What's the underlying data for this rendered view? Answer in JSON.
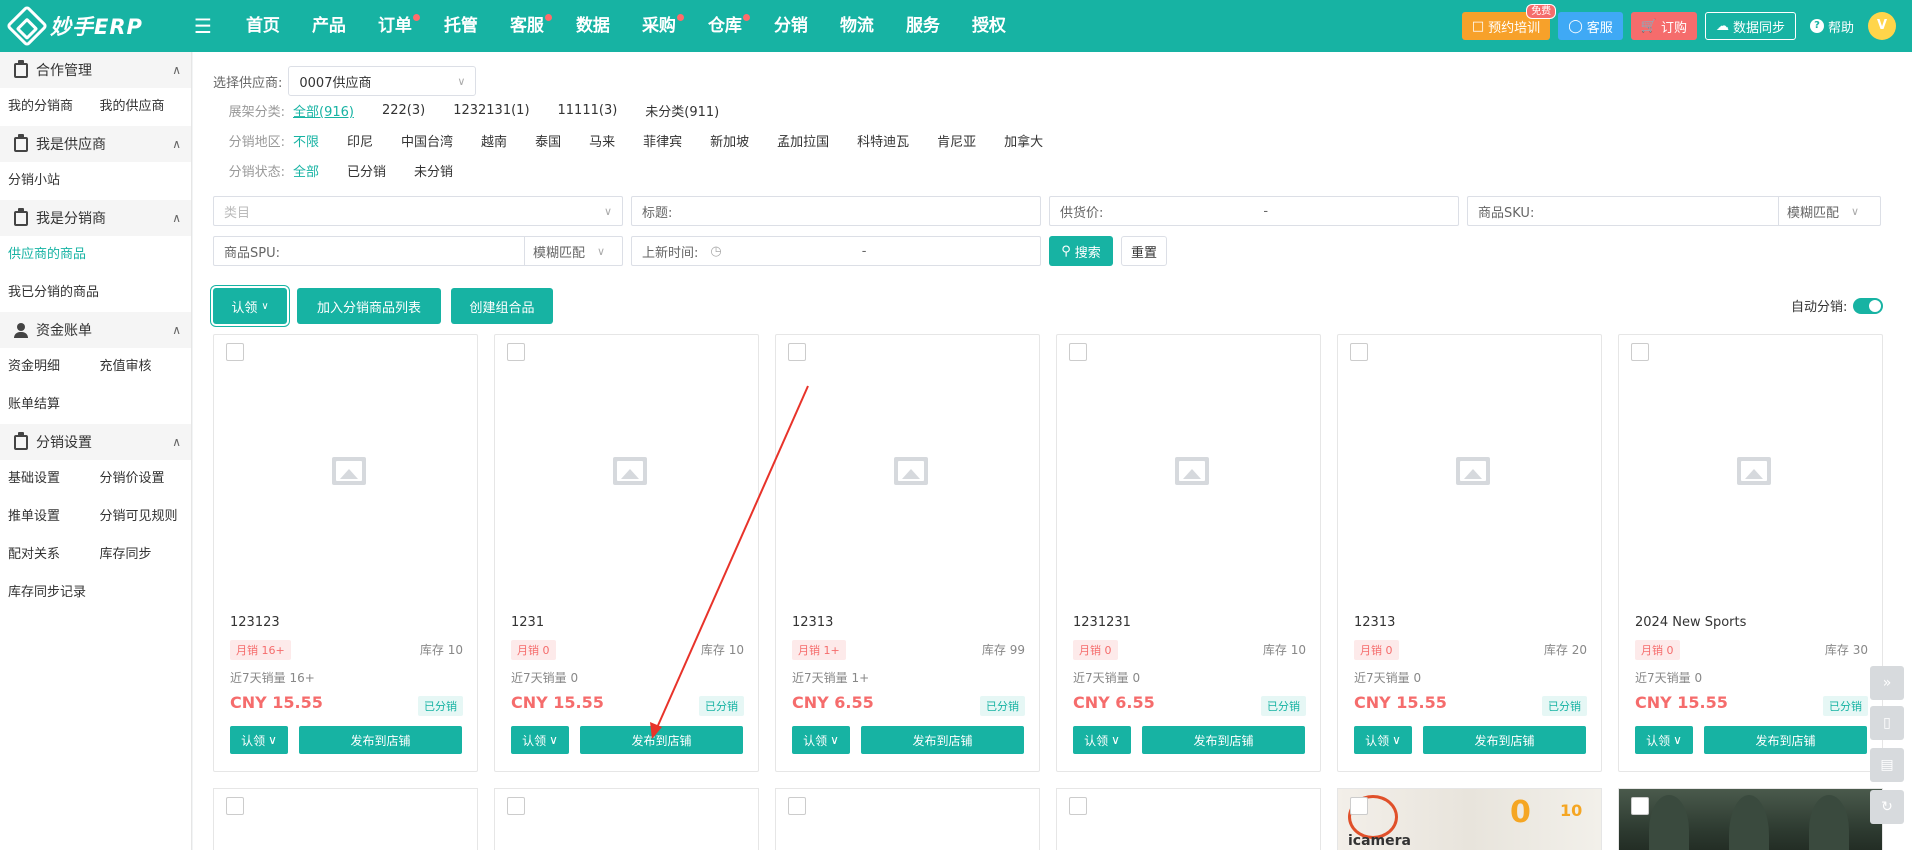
{
  "header": {
    "logo_text": "妙手ERP",
    "nav": [
      {
        "label": "首页",
        "dot": false
      },
      {
        "label": "产品",
        "dot": false
      },
      {
        "label": "订单",
        "dot": true
      },
      {
        "label": "托管",
        "dot": false
      },
      {
        "label": "客服",
        "dot": true
      },
      {
        "label": "数据",
        "dot": false
      },
      {
        "label": "采购",
        "dot": true
      },
      {
        "label": "仓库",
        "dot": true
      },
      {
        "label": "分销",
        "dot": false
      },
      {
        "label": "物流",
        "dot": false
      },
      {
        "label": "服务",
        "dot": false
      },
      {
        "label": "授权",
        "dot": false
      }
    ],
    "training_label": "预约培训",
    "free_badge": "免费",
    "service_label": "客服",
    "subscribe_label": "订购",
    "sync_label": "数据同步",
    "help_label": "帮助",
    "avatar_letter": "V"
  },
  "sidebar": {
    "groups": [
      {
        "title": "合作管理",
        "icon": "clipboard-icon",
        "items": [
          "我的分销商",
          "我的供应商"
        ]
      },
      {
        "title": "我是供应商",
        "icon": "clipboard-icon",
        "items": [
          "分销小站"
        ]
      },
      {
        "title": "我是分销商",
        "icon": "clipboard-icon",
        "items": [
          "供应商的商品",
          "我已分销的商品"
        ]
      },
      {
        "title": "资金账单",
        "icon": "user-icon",
        "items": [
          "资金明细",
          "充值审核",
          "账单结算"
        ]
      },
      {
        "title": "分销设置",
        "icon": "clipboard-icon",
        "items": [
          "基础设置",
          "分销价设置",
          "推单设置",
          "分销可见规则",
          "配对关系",
          "库存同步",
          "库存同步记录"
        ]
      }
    ],
    "active_item": "供应商的商品"
  },
  "filters": {
    "supplier_label": "选择供应商:",
    "supplier_value": "0007供应商",
    "category_label": "展架分类:",
    "category_options": [
      "全部(916)",
      "222(3)",
      "1232131(1)",
      "11111(3)",
      "未分类(911)"
    ],
    "region_label": "分销地区:",
    "region_options": [
      "不限",
      "印尼",
      "中国台湾",
      "越南",
      "泰国",
      "马来",
      "菲律宾",
      "新加坡",
      "孟加拉国",
      "科特迪瓦",
      "肯尼亚",
      "加拿大"
    ],
    "status_label": "分销状态:",
    "status_options": [
      "全部",
      "已分销",
      "未分销"
    ]
  },
  "search": {
    "category_placeholder": "类目",
    "title_label": "标题:",
    "price_label": "供货价:",
    "price_sep": "-",
    "sku_label": "商品SKU:",
    "sku_match": "模糊匹配",
    "spu_label": "商品SPU:",
    "spu_match": "模糊匹配",
    "time_label": "上新时间:",
    "time_sep": "-",
    "search_btn": "搜索",
    "reset_btn": "重置"
  },
  "toolbar": {
    "claim_label": "认领",
    "add_list_label": "加入分销商品列表",
    "create_combo_label": "创建组合品",
    "auto_dist_label": "自动分销:"
  },
  "products": [
    {
      "title": "123123",
      "month_sales": "月销 16+",
      "stock": "库存 10",
      "sales7": "近7天销量 16+",
      "price": "CNY 15.55",
      "status": "已分销"
    },
    {
      "title": "1231",
      "month_sales": "月销 0",
      "stock": "库存 10",
      "sales7": "近7天销量 0",
      "price": "CNY 15.55",
      "status": "已分销"
    },
    {
      "title": "12313",
      "month_sales": "月销 1+",
      "stock": "库存 99",
      "sales7": "近7天销量 1+",
      "price": "CNY 6.55",
      "status": "已分销"
    },
    {
      "title": "1231231",
      "month_sales": "月销 0",
      "stock": "库存 10",
      "sales7": "近7天销量 0",
      "price": "CNY 6.55",
      "status": "已分销"
    },
    {
      "title": "12313",
      "month_sales": "月销 0",
      "stock": "库存 20",
      "sales7": "近7天销量 0",
      "price": "CNY 15.55",
      "status": "已分销"
    },
    {
      "title": "2024 New Sports",
      "month_sales": "月销 0",
      "stock": "库存 30",
      "sales7": "近7天销量 0",
      "price": "CNY 15.55",
      "status": "已分销"
    }
  ],
  "card_actions": {
    "claim": "认领",
    "publish": "发布到店铺"
  },
  "banner": {
    "brand": "icamera",
    "big0": "0",
    "big10": "10"
  },
  "colors": {
    "primary": "#17b3a3",
    "price_red": "#f56c6c",
    "annotation_arrow": "#e8332a"
  }
}
